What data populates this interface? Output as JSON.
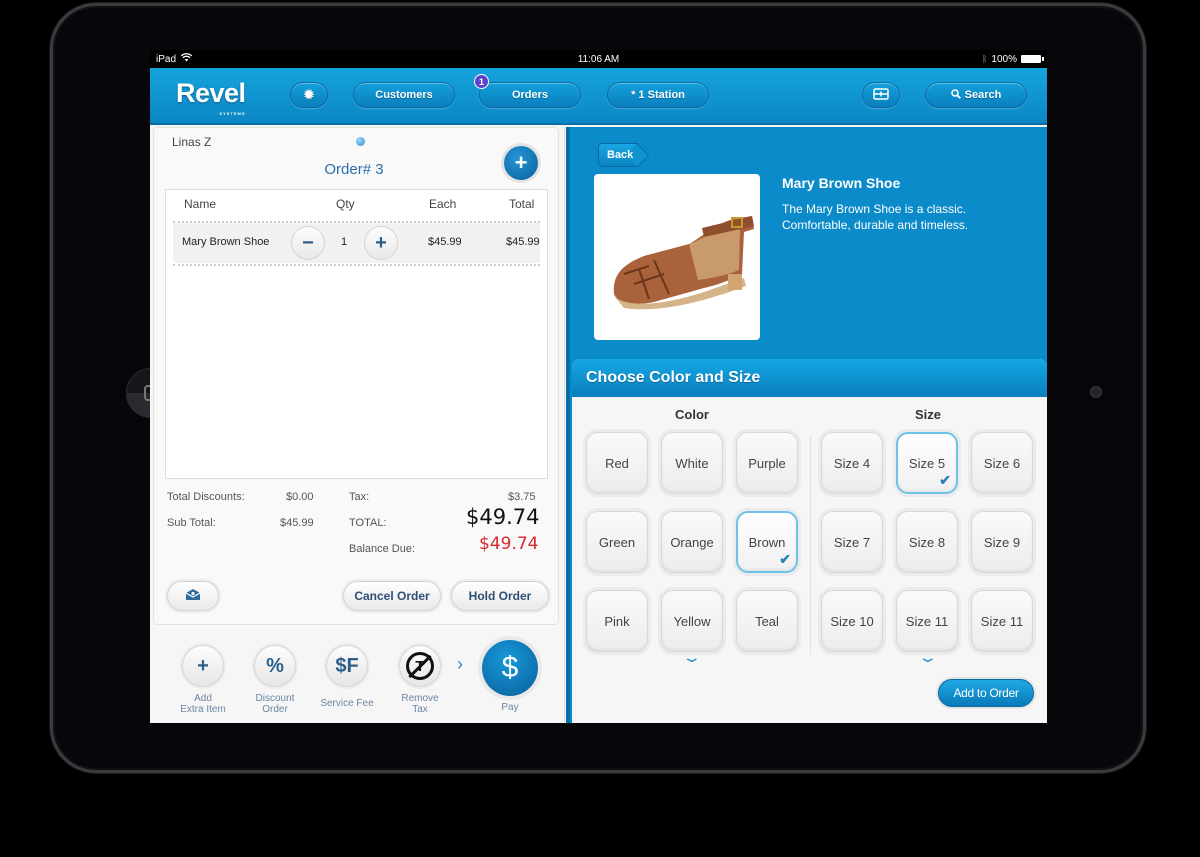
{
  "status_bar": {
    "device": "iPad",
    "time": "11:06 AM",
    "battery": "100%"
  },
  "header": {
    "logo": "Revel",
    "logo_sub": "SYSTEMS",
    "customers_label": "Customers",
    "orders_label": "Orders",
    "orders_badge": "1",
    "station_label": "* 1 Station",
    "search_label": "Search"
  },
  "order": {
    "customer": "Linas Z",
    "title": "Order# 3",
    "columns": [
      "Name",
      "Qty",
      "Each",
      "Total"
    ],
    "items": [
      {
        "name": "Mary Brown Shoe",
        "qty": "1",
        "each": "$45.99",
        "total": "$45.99"
      }
    ],
    "totals": {
      "discounts_label": "Total Discounts:",
      "discounts_value": "$0.00",
      "subtotal_label": "Sub Total:",
      "subtotal_value": "$45.99",
      "tax_label": "Tax:",
      "tax_value": "$3.75",
      "total_label": "TOTAL:",
      "total_value": "$49.74",
      "balance_label": "Balance Due:",
      "balance_value": "$49.74"
    },
    "cancel_label": "Cancel Order",
    "hold_label": "Hold Order"
  },
  "actions": [
    {
      "glyph": "+",
      "label1": "Add",
      "label2": "Extra Item"
    },
    {
      "glyph": "%",
      "label1": "Discount",
      "label2": "Order"
    },
    {
      "glyph": "$F",
      "label1": "Service Fee",
      "label2": ""
    },
    {
      "glyph": "T",
      "label1": "Remove",
      "label2": "Tax"
    }
  ],
  "more_glyph": "›",
  "pay": {
    "glyph": "$",
    "label": "Pay"
  },
  "product": {
    "back_label": "Back",
    "name": "Mary Brown Shoe",
    "description": "The Mary Brown Shoe is a classic. Comfortable, durable and timeless."
  },
  "chooser": {
    "title": "Choose Color and Size",
    "color_heading": "Color",
    "size_heading": "Size",
    "colors": [
      "Red",
      "White",
      "Purple",
      "Green",
      "Orange",
      "Brown",
      "Pink",
      "Yellow",
      "Teal"
    ],
    "selected_color": "Brown",
    "sizes": [
      "Size 4",
      "Size 5",
      "Size 6",
      "Size 7",
      "Size 8",
      "Size 9",
      "Size 10",
      "Size 11",
      "Size 11"
    ],
    "selected_size": "Size 5",
    "add_label": "Add to Order"
  },
  "colors": {
    "brand_blue": "#0b8bc9",
    "balance_red": "#d8282e",
    "badge_purple": "#5b43c9"
  }
}
